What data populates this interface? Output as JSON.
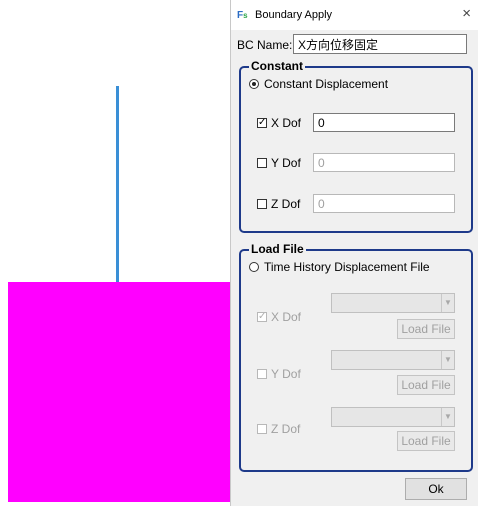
{
  "titlebar": {
    "icon": "app-logo-icon",
    "title": "Boundary Apply",
    "close_label": "×"
  },
  "bc_name": {
    "label": "BC Name:",
    "value": "X方向位移固定"
  },
  "constant_group": {
    "title": "Constant",
    "radio_label": "Constant Displacement",
    "radio_selected": true,
    "dofs": [
      {
        "label": "X Dof",
        "checked": true,
        "checkmark": "☑",
        "value": "0",
        "enabled": true
      },
      {
        "label": "Y Dof",
        "checked": false,
        "checkmark": "",
        "value": "0",
        "enabled": false
      },
      {
        "label": "Z Dof",
        "checked": false,
        "checkmark": "",
        "value": "0",
        "enabled": false
      }
    ]
  },
  "load_group": {
    "title": "Load File",
    "radio_label": "Time History Displacement File",
    "radio_selected": false,
    "dofs": [
      {
        "label": "X Dof",
        "checked": true,
        "checkmark": "✓",
        "button": "Load File"
      },
      {
        "label": "Y Dof",
        "checked": false,
        "checkmark": "",
        "button": "Load File"
      },
      {
        "label": "Z Dof",
        "checked": false,
        "checkmark": "",
        "button": "Load File"
      }
    ]
  },
  "footer": {
    "ok_label": "Ok"
  },
  "colors": {
    "accent_group_border": "#1e3a8a",
    "viewport_line": "#3a8fd6",
    "viewport_block": "#ff00ff"
  }
}
